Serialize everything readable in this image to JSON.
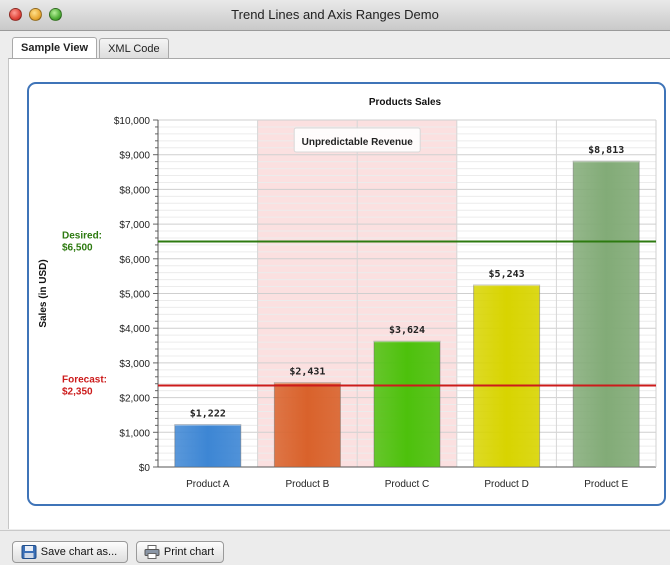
{
  "window": {
    "title": "Trend Lines and Axis Ranges Demo"
  },
  "tabs": [
    {
      "label": "Sample View",
      "active": true
    },
    {
      "label": "XML Code",
      "active": false
    }
  ],
  "buttons": {
    "save": "Save chart as...",
    "print": "Print chart"
  },
  "icons": {
    "save": "floppy-disk-icon",
    "print": "printer-icon"
  },
  "chart_data": {
    "type": "bar",
    "title": "Products Sales",
    "xlabel": "",
    "ylabel": "Sales (in USD)",
    "ylim": [
      0,
      10000
    ],
    "y_ticks": [
      "$0",
      "$1,000",
      "$2,000",
      "$3,000",
      "$4,000",
      "$5,000",
      "$6,000",
      "$7,000",
      "$8,000",
      "$9,000",
      "$10,000"
    ],
    "categories": [
      "Product A",
      "Product B",
      "Product C",
      "Product D",
      "Product E"
    ],
    "values": [
      1222,
      2431,
      3624,
      5243,
      8813
    ],
    "value_labels": [
      "$1,222",
      "$2,431",
      "$3,624",
      "$5,243",
      "$8,813"
    ],
    "bar_colors": [
      "#3d86d4",
      "#d9622b",
      "#4dc10c",
      "#d8d400",
      "#82ab77"
    ],
    "trend_lines": [
      {
        "label": "Desired:",
        "value_label": "$6,500",
        "value": 6500,
        "color": "#2d7a10"
      },
      {
        "label": "Forecast:",
        "value_label": "$2,350",
        "value": 2350,
        "color": "#cc1b1b"
      }
    ],
    "x_range": {
      "label": "Unpredictable Revenue",
      "from": "Product B",
      "to": "Product C",
      "color": "#fbe0e0"
    },
    "grid": true
  }
}
